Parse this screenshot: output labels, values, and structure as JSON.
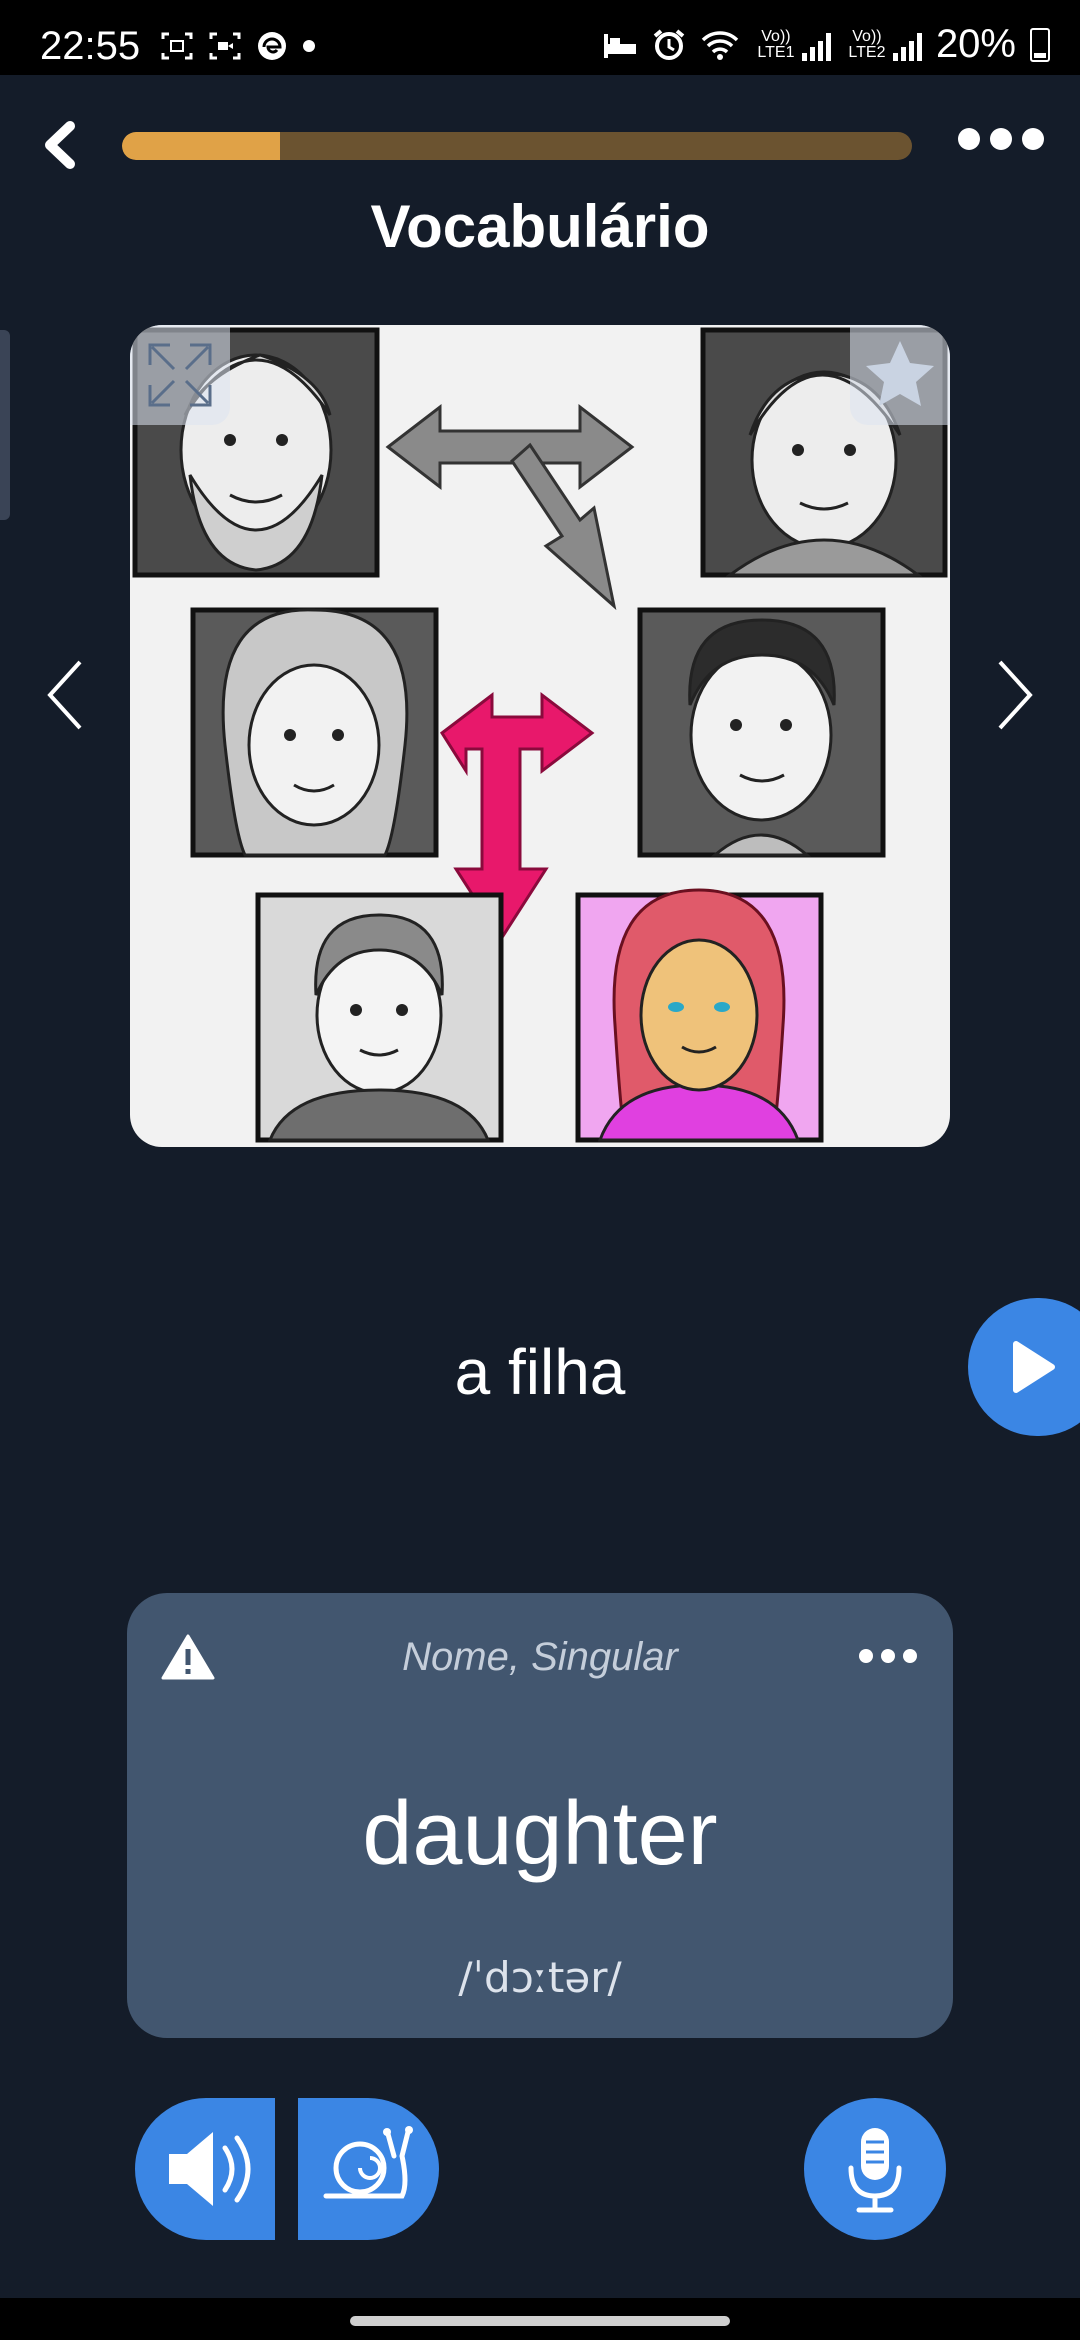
{
  "status_bar": {
    "time": "22:55",
    "battery": "20%",
    "sim1": "Vo)) LTE1",
    "sim2": "Vo)) LTE2",
    "icons": [
      "screenshot-icon",
      "screen-record-icon",
      "edge-browser-icon",
      "dot-icon",
      "sleep-mode-icon",
      "alarm-icon",
      "wifi-icon",
      "signal-icon",
      "battery-icon"
    ]
  },
  "header": {
    "title": "Vocabulário",
    "progress_fraction": 0.2
  },
  "colors": {
    "background": "#141c29",
    "accent_blue": "#3b86e4",
    "progress_fill": "#e0a247",
    "progress_track": "#6b5330",
    "card": "#42566f",
    "arrow_pink": "#e8186b"
  },
  "flashcard": {
    "image_description_icons": [
      "expand-icon",
      "star-icon",
      "family-tree-illustration"
    ],
    "word": "a filha",
    "translation": {
      "part_of_speech": "Nome, Singular",
      "text": "daughter",
      "ipa": "/ˈdɔːtər/"
    }
  },
  "controls": {
    "icons": [
      "speaker-icon",
      "snail-icon",
      "microphone-icon",
      "play-icon",
      "chevron-left-icon",
      "chevron-right-icon",
      "back-chevron-icon",
      "more-icon",
      "warning-icon"
    ]
  }
}
